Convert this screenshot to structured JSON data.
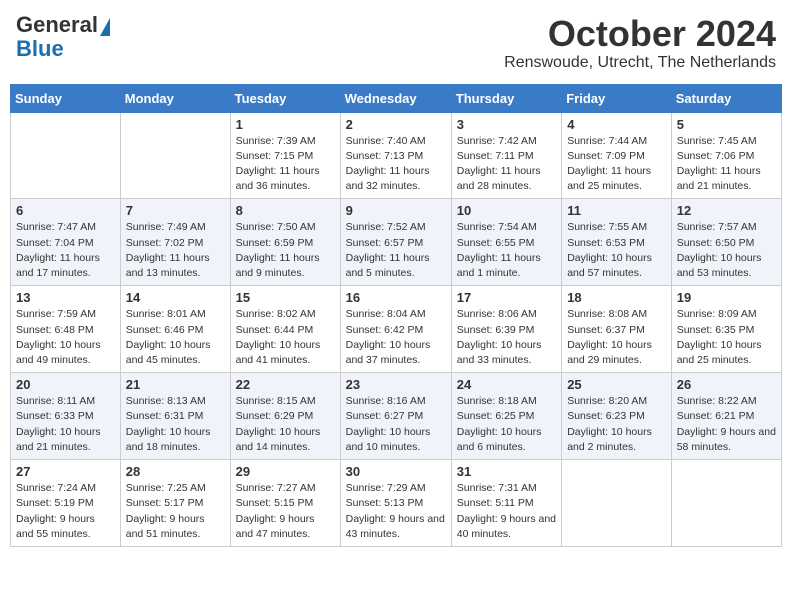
{
  "header": {
    "logo_line1": "General",
    "logo_line2": "Blue",
    "month": "October 2024",
    "location": "Renswoude, Utrecht, The Netherlands"
  },
  "weekdays": [
    "Sunday",
    "Monday",
    "Tuesday",
    "Wednesday",
    "Thursday",
    "Friday",
    "Saturday"
  ],
  "weeks": [
    [
      {
        "day": "",
        "info": ""
      },
      {
        "day": "",
        "info": ""
      },
      {
        "day": "1",
        "info": "Sunrise: 7:39 AM\nSunset: 7:15 PM\nDaylight: 11 hours and 36 minutes."
      },
      {
        "day": "2",
        "info": "Sunrise: 7:40 AM\nSunset: 7:13 PM\nDaylight: 11 hours and 32 minutes."
      },
      {
        "day": "3",
        "info": "Sunrise: 7:42 AM\nSunset: 7:11 PM\nDaylight: 11 hours and 28 minutes."
      },
      {
        "day": "4",
        "info": "Sunrise: 7:44 AM\nSunset: 7:09 PM\nDaylight: 11 hours and 25 minutes."
      },
      {
        "day": "5",
        "info": "Sunrise: 7:45 AM\nSunset: 7:06 PM\nDaylight: 11 hours and 21 minutes."
      }
    ],
    [
      {
        "day": "6",
        "info": "Sunrise: 7:47 AM\nSunset: 7:04 PM\nDaylight: 11 hours and 17 minutes."
      },
      {
        "day": "7",
        "info": "Sunrise: 7:49 AM\nSunset: 7:02 PM\nDaylight: 11 hours and 13 minutes."
      },
      {
        "day": "8",
        "info": "Sunrise: 7:50 AM\nSunset: 6:59 PM\nDaylight: 11 hours and 9 minutes."
      },
      {
        "day": "9",
        "info": "Sunrise: 7:52 AM\nSunset: 6:57 PM\nDaylight: 11 hours and 5 minutes."
      },
      {
        "day": "10",
        "info": "Sunrise: 7:54 AM\nSunset: 6:55 PM\nDaylight: 11 hours and 1 minute."
      },
      {
        "day": "11",
        "info": "Sunrise: 7:55 AM\nSunset: 6:53 PM\nDaylight: 10 hours and 57 minutes."
      },
      {
        "day": "12",
        "info": "Sunrise: 7:57 AM\nSunset: 6:50 PM\nDaylight: 10 hours and 53 minutes."
      }
    ],
    [
      {
        "day": "13",
        "info": "Sunrise: 7:59 AM\nSunset: 6:48 PM\nDaylight: 10 hours and 49 minutes."
      },
      {
        "day": "14",
        "info": "Sunrise: 8:01 AM\nSunset: 6:46 PM\nDaylight: 10 hours and 45 minutes."
      },
      {
        "day": "15",
        "info": "Sunrise: 8:02 AM\nSunset: 6:44 PM\nDaylight: 10 hours and 41 minutes."
      },
      {
        "day": "16",
        "info": "Sunrise: 8:04 AM\nSunset: 6:42 PM\nDaylight: 10 hours and 37 minutes."
      },
      {
        "day": "17",
        "info": "Sunrise: 8:06 AM\nSunset: 6:39 PM\nDaylight: 10 hours and 33 minutes."
      },
      {
        "day": "18",
        "info": "Sunrise: 8:08 AM\nSunset: 6:37 PM\nDaylight: 10 hours and 29 minutes."
      },
      {
        "day": "19",
        "info": "Sunrise: 8:09 AM\nSunset: 6:35 PM\nDaylight: 10 hours and 25 minutes."
      }
    ],
    [
      {
        "day": "20",
        "info": "Sunrise: 8:11 AM\nSunset: 6:33 PM\nDaylight: 10 hours and 21 minutes."
      },
      {
        "day": "21",
        "info": "Sunrise: 8:13 AM\nSunset: 6:31 PM\nDaylight: 10 hours and 18 minutes."
      },
      {
        "day": "22",
        "info": "Sunrise: 8:15 AM\nSunset: 6:29 PM\nDaylight: 10 hours and 14 minutes."
      },
      {
        "day": "23",
        "info": "Sunrise: 8:16 AM\nSunset: 6:27 PM\nDaylight: 10 hours and 10 minutes."
      },
      {
        "day": "24",
        "info": "Sunrise: 8:18 AM\nSunset: 6:25 PM\nDaylight: 10 hours and 6 minutes."
      },
      {
        "day": "25",
        "info": "Sunrise: 8:20 AM\nSunset: 6:23 PM\nDaylight: 10 hours and 2 minutes."
      },
      {
        "day": "26",
        "info": "Sunrise: 8:22 AM\nSunset: 6:21 PM\nDaylight: 9 hours and 58 minutes."
      }
    ],
    [
      {
        "day": "27",
        "info": "Sunrise: 7:24 AM\nSunset: 5:19 PM\nDaylight: 9 hours and 55 minutes."
      },
      {
        "day": "28",
        "info": "Sunrise: 7:25 AM\nSunset: 5:17 PM\nDaylight: 9 hours and 51 minutes."
      },
      {
        "day": "29",
        "info": "Sunrise: 7:27 AM\nSunset: 5:15 PM\nDaylight: 9 hours and 47 minutes."
      },
      {
        "day": "30",
        "info": "Sunrise: 7:29 AM\nSunset: 5:13 PM\nDaylight: 9 hours and 43 minutes."
      },
      {
        "day": "31",
        "info": "Sunrise: 7:31 AM\nSunset: 5:11 PM\nDaylight: 9 hours and 40 minutes."
      },
      {
        "day": "",
        "info": ""
      },
      {
        "day": "",
        "info": ""
      }
    ]
  ]
}
